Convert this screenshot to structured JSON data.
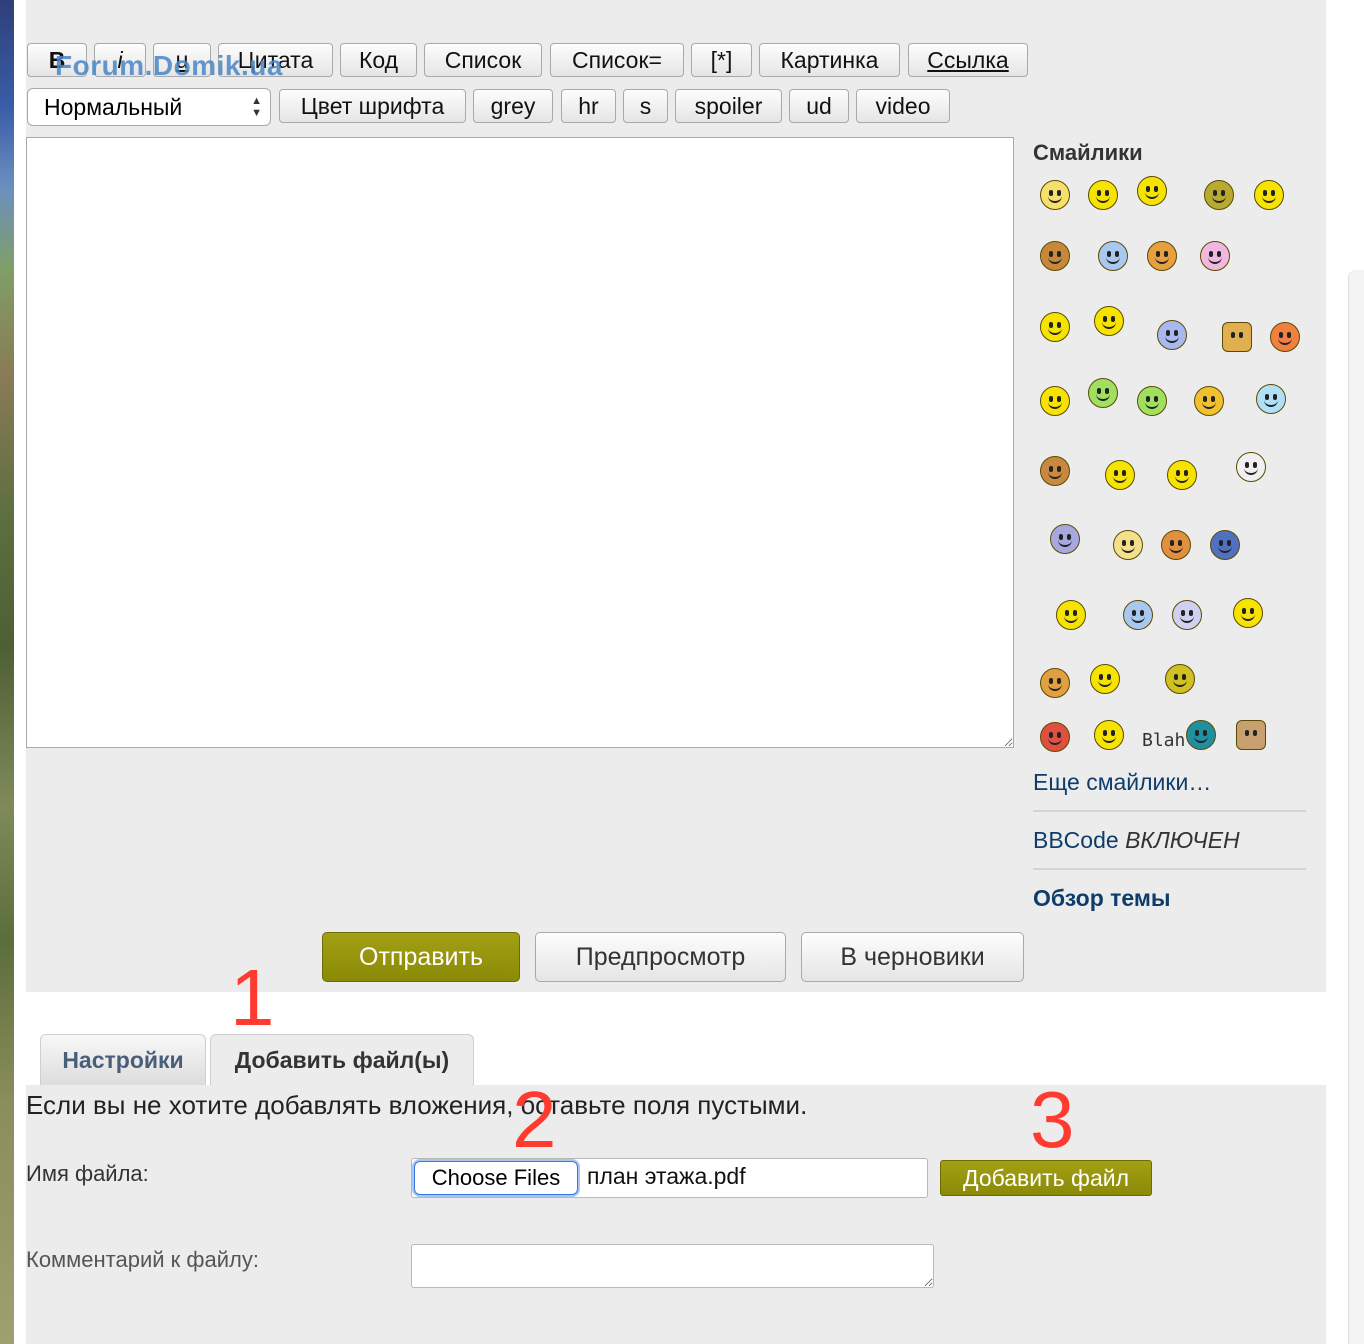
{
  "toolbar": {
    "row1": [
      "B",
      "i",
      "u",
      "Цитата",
      "Код",
      "Список",
      "Список=",
      "[*]",
      "Картинка",
      "Ссылка"
    ],
    "font_size_select": "Нормальный",
    "row2": [
      "Цвет шрифта",
      "grey",
      "hr",
      "s",
      "spoiler",
      "ud",
      "video"
    ]
  },
  "watermark": "Forum.Domik.ua",
  "smilies": {
    "title": "Смайлики",
    "more_link": "Еще смайлики…",
    "blah_label": "Blah"
  },
  "bbcode": {
    "label": "BBCode",
    "status": "ВКЛЮЧЕН"
  },
  "topic_review": "Обзор темы",
  "actions": {
    "submit": "Отправить",
    "preview": "Предпросмотр",
    "draft": "В черновики"
  },
  "tabs": {
    "settings": "Настройки",
    "attachments": "Добавить файл(ы)"
  },
  "attachments": {
    "hint": "Если вы не хотите добавлять вложения, оставьте поля пустыми.",
    "filename_label": "Имя файла:",
    "choose_files": "Choose Files",
    "selected_file": "план этажа.pdf",
    "add_file_button": "Добавить файл",
    "comment_label": "Комментарий к файлу:"
  },
  "annotations": [
    "1",
    "2",
    "3"
  ],
  "colors": {
    "accent": "#9a9810",
    "link": "#0e3d6b",
    "annotation": "#ff3b30",
    "panel": "#ececec"
  }
}
